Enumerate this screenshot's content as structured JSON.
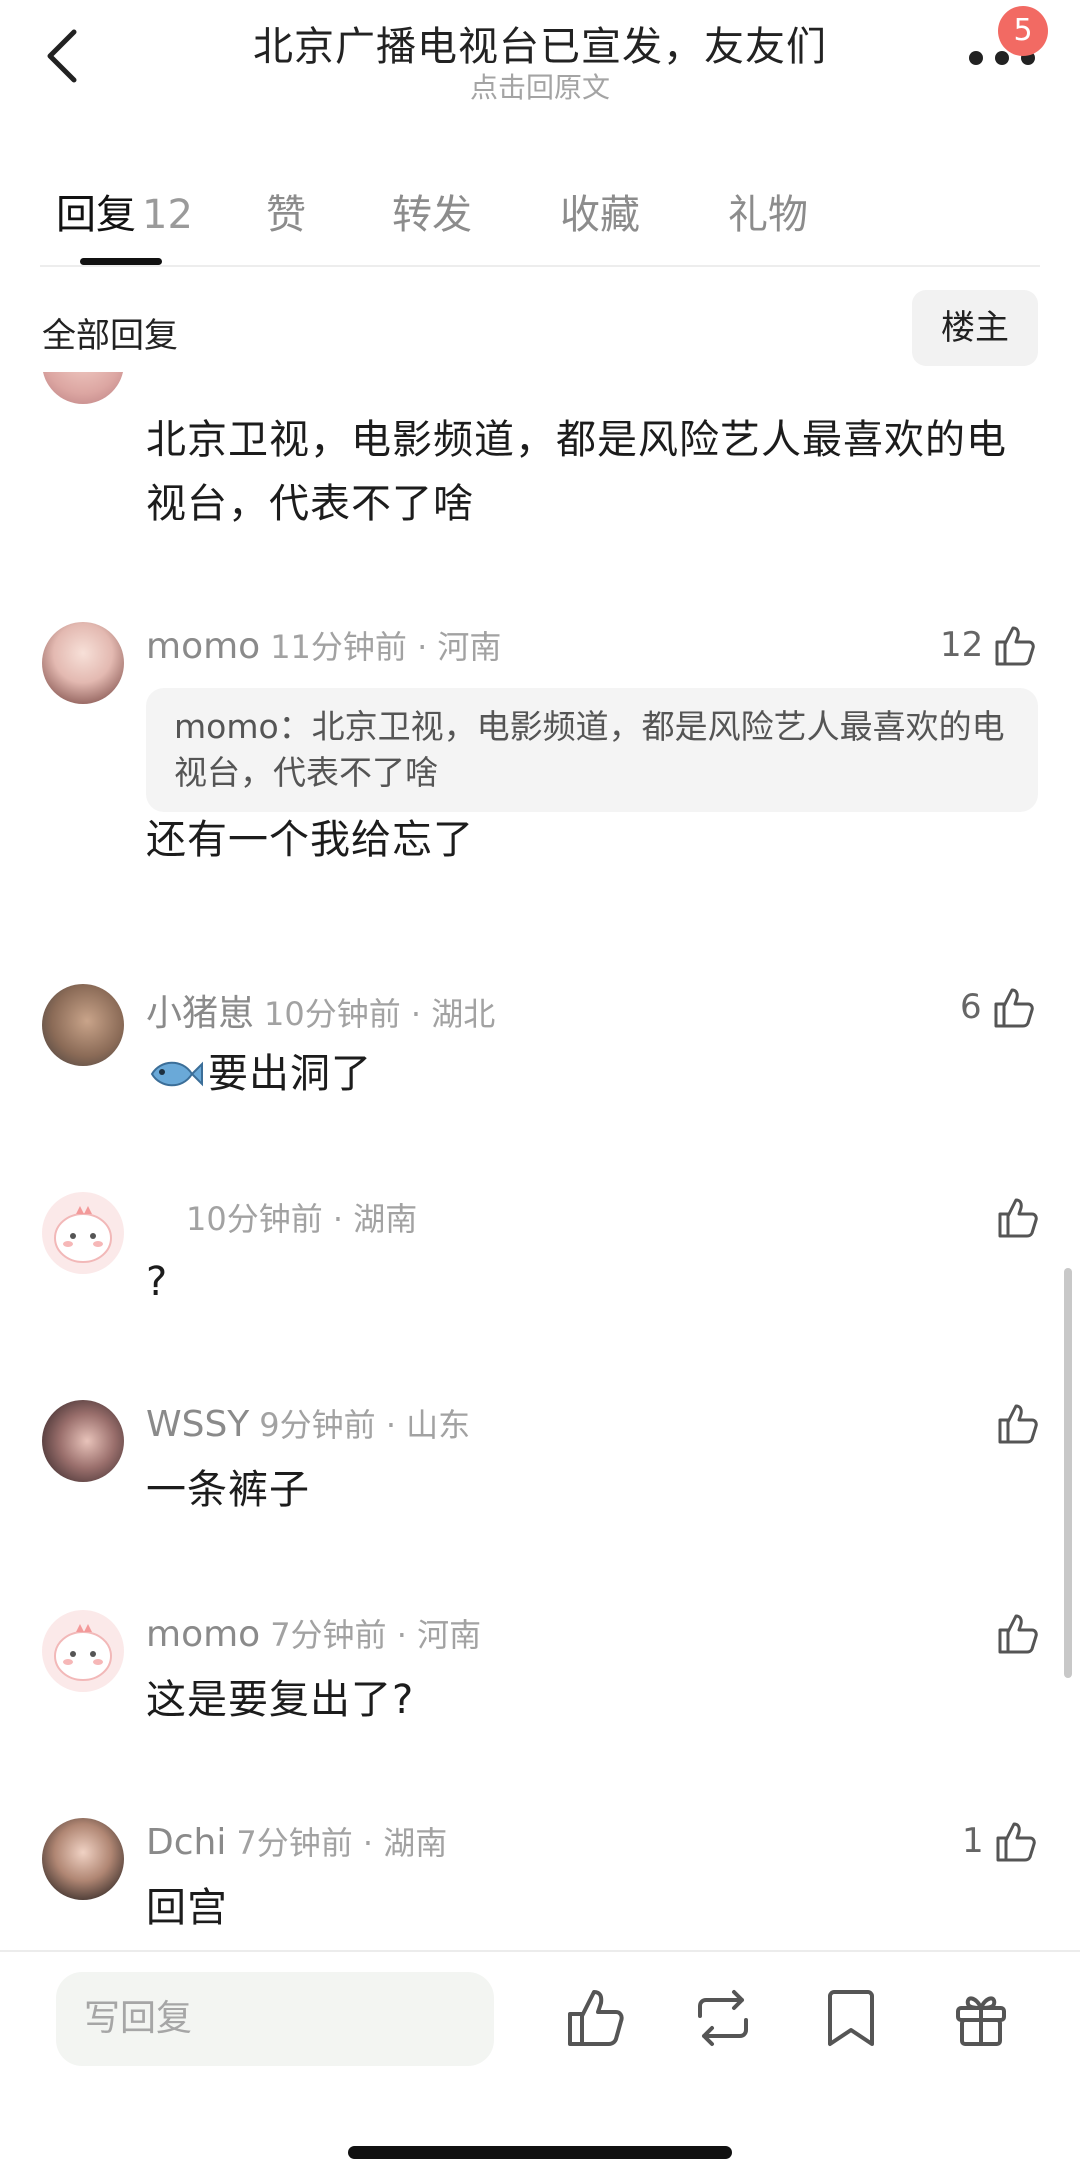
{
  "header": {
    "title": "北京广播电视台已宣发，友友们",
    "subtitle": "点击回原文",
    "badge_count": "5"
  },
  "tabs": [
    {
      "label": "回复",
      "count": "12",
      "active": true
    },
    {
      "label": "赞"
    },
    {
      "label": "转发"
    },
    {
      "label": "收藏"
    },
    {
      "label": "礼物"
    }
  ],
  "filter": {
    "label": "全部回复",
    "owner_button": "楼主"
  },
  "partial_comment": {
    "text": "北京卫视，电影频道，都是风险艺人最喜欢的电视台，代表不了啥"
  },
  "comments": [
    {
      "user": "momo",
      "meta": "11分钟前 · 河南",
      "likes": "12",
      "quote": "momo：北京卫视，电影频道，都是风险艺人最喜欢的电视台，代表不了啥",
      "text": "还有一个我给忘了"
    },
    {
      "user": "小猪崽",
      "meta": "10分钟前 · 湖北",
      "likes": "6",
      "text": "要出洞了"
    },
    {
      "user": "",
      "meta": "10分钟前 · 湖南",
      "likes": "",
      "text": "?"
    },
    {
      "user": "WSSY",
      "meta": "9分钟前 · 山东",
      "likes": "",
      "text": "一条裤子"
    },
    {
      "user": "momo",
      "meta": "7分钟前 · 河南",
      "likes": "",
      "text": "这是要复出了?"
    },
    {
      "user": "Dchi",
      "meta": "7分钟前 · 湖南",
      "likes": "1",
      "text": "回宫"
    }
  ],
  "bottom_bar": {
    "placeholder": "写回复",
    "icons": [
      "thumbs-up-icon",
      "repost-icon",
      "bookmark-icon",
      "gift-icon"
    ]
  }
}
